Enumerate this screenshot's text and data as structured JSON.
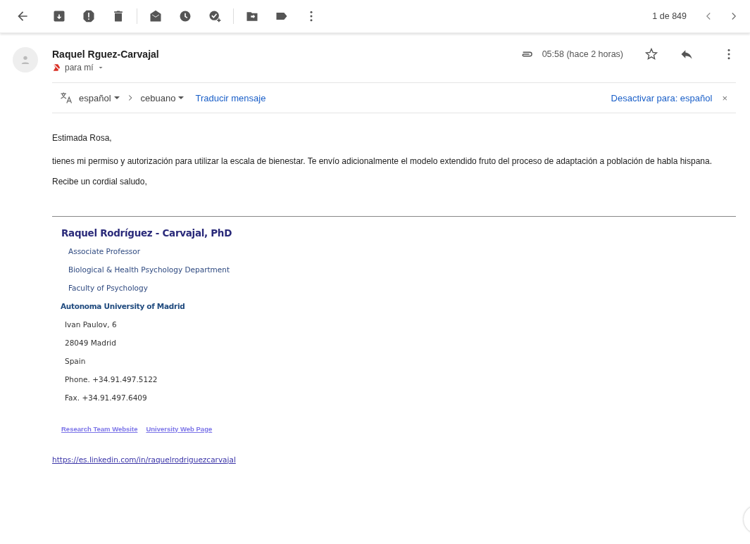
{
  "toolbar": {
    "counter": "1 de 849"
  },
  "message": {
    "sender": "Raquel Rguez-Carvajal",
    "recipient": "para mí",
    "time": "05:58 (hace 2 horas)",
    "starred": false
  },
  "translate_bar": {
    "source": "español",
    "target": "cebuano",
    "translate_link": "Traducir mensaje",
    "disable_link": "Desactivar para: español",
    "close": "×"
  },
  "body": [
    "Estimada Rosa,",
    "tienes mi permiso y autorización para utilizar la escala de bienestar. Te envío adicionalmente el modelo extendido fruto del proceso de adaptación a población de habla hispana.",
    "Recibe un cordial saludo,"
  ],
  "signature": [
    {
      "kind": "name",
      "text": "Raquel Rodríguez - Carvajal, PhD"
    },
    {
      "kind": "title",
      "text": "Associate Professor"
    },
    {
      "kind": "title",
      "text": "Biological & Health Psychology Department"
    },
    {
      "kind": "title",
      "text": "Faculty of Psychology"
    },
    {
      "kind": "org",
      "text": "Autonoma University of Madrid"
    },
    {
      "kind": "address",
      "text": "Ivan Paulov, 6"
    },
    {
      "kind": "address",
      "text": "28049 Madrid"
    },
    {
      "kind": "address",
      "text": "Spain"
    },
    {
      "kind": "address",
      "text": "Phone. +34.91.497.5122"
    },
    {
      "kind": "address",
      "text": "Fax. +34.91.497.6409"
    }
  ],
  "signature_links": [
    "Research Team Website",
    "University Web Page"
  ],
  "profile_link": "https://es.linkedin.com/in/raquelrodriguezcarvajal"
}
